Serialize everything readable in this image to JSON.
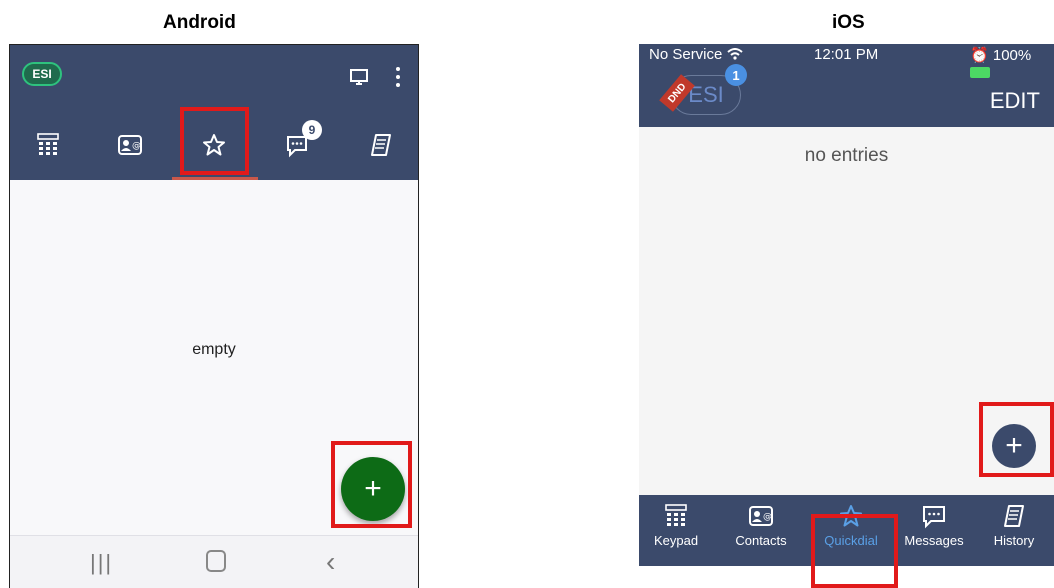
{
  "labels": {
    "android": "Android",
    "ios": "iOS"
  },
  "android": {
    "esi_logo": "ESI",
    "messages_badge": "9",
    "empty_text": "empty",
    "fab_label": "+",
    "tabs": [
      "keypad-icon",
      "contacts-icon",
      "star-icon",
      "messages-icon",
      "history-icon"
    ],
    "selected_tab": "star-icon"
  },
  "ios": {
    "status": {
      "carrier": "No Service",
      "time": "12:01 PM",
      "battery": "100%"
    },
    "esi_logo": "ESI",
    "dnd": "DND",
    "notification_badge": "1",
    "edit_button": "EDIT",
    "empty_text": "no entries",
    "fab_label": "+",
    "tabs": [
      {
        "label": "Keypad",
        "icon": "keypad-icon"
      },
      {
        "label": "Contacts",
        "icon": "contacts-icon"
      },
      {
        "label": "Quickdial",
        "icon": "star-icon"
      },
      {
        "label": "Messages",
        "icon": "messages-icon"
      },
      {
        "label": "History",
        "icon": "history-icon"
      }
    ],
    "selected_tab": "Quickdial"
  },
  "colors": {
    "header": "#3b4a6b",
    "android_fab": "#0d6b16",
    "highlight": "#e11a1a",
    "ios_active": "#5aa0e6"
  }
}
